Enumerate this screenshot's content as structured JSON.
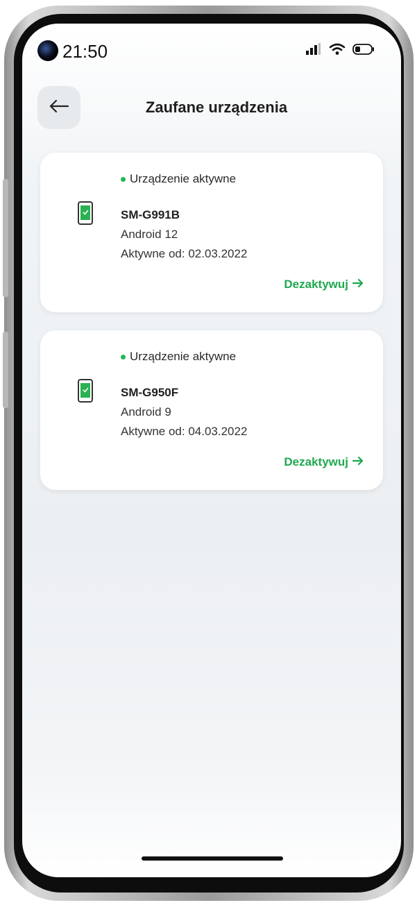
{
  "status_bar": {
    "time": "21:50",
    "icons": [
      "signal-icon",
      "wifi-icon",
      "battery-icon"
    ]
  },
  "header": {
    "title": "Zaufane urządzenia",
    "back_icon": "arrow-left-icon"
  },
  "devices": [
    {
      "status": "Urządzenie aktywne",
      "name": "SM-G991B",
      "os": "Android 12",
      "active_since": "Aktywne od: 02.03.2022",
      "action": "Dezaktywuj"
    },
    {
      "status": "Urządzenie aktywne",
      "name": "SM-G950F",
      "os": "Android 9",
      "active_since": "Aktywne od: 04.03.2022",
      "action": "Dezaktywuj"
    }
  ],
  "colors": {
    "accent_green": "#1fa84f",
    "status_dot": "#1db954",
    "card_background": "#ffffff",
    "screen_background": "#eceff2"
  }
}
